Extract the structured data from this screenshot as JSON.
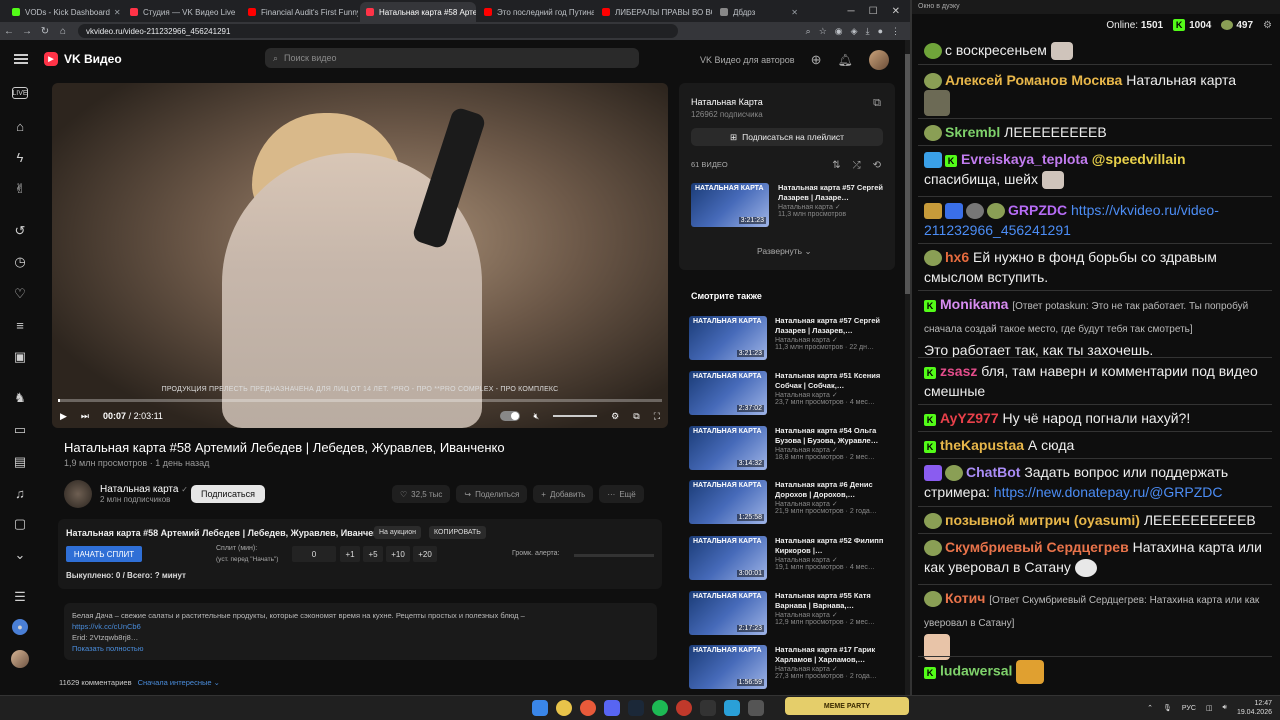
{
  "browser": {
    "tabs": [
      {
        "label": "VODs - Kick Dashboard",
        "color": "#53fc18",
        "active": false
      },
      {
        "label": "Студия — VK Видео Live",
        "color": "#ff3347",
        "active": false
      },
      {
        "label": "Financial Audit's First Funny",
        "color": "#ff0000",
        "active": false
      },
      {
        "label": "Натальная карта #58 Артем",
        "color": "#ff3347",
        "active": true
      },
      {
        "label": "Это последний год Путина",
        "color": "#ff0000",
        "active": false
      },
      {
        "label": "ЛИБЕРАЛЫ ПРАВЫ ВО ВСЁМ",
        "color": "#ff0000",
        "active": false
      },
      {
        "label": "Дбдрз",
        "color": "#888888",
        "active": false
      }
    ],
    "url": "vkvideo.ru/video-211232966_456241291"
  },
  "vk": {
    "logo": "VK Видео",
    "search_placeholder": "Поиск видео",
    "for_authors": "VK Видео для авторов",
    "video": {
      "subtitle": "ПРОДУКЦИЯ ПРЕЛЕСТЬ ПРЕДНАЗНАЧЕНА ДЛЯ ЛИЦ ОТ 14 ЛЕТ. *PRO - ПРО **PRO COMPLEX - ПРО КОМПЛЕКС",
      "time_current": "00:07",
      "time_total": "/ 2:03:11",
      "progress": 0.001
    },
    "title": "Натальная карта #58 Артемий Лебедев | Лебедев, Журавлев, Иванченко",
    "views": "1,9 млн просмотров",
    "age": "1 день назад",
    "channel": {
      "name": "Натальная карта",
      "subs": "2 млн подписчиков",
      "subscribe": "Подписаться"
    },
    "actions": {
      "likes": "32,5 тыс",
      "share": "Поделиться",
      "add": "Добавить",
      "more": "Ещё"
    },
    "split": {
      "title": "Натальная карта #58 Артемий Лебедев | Лебедев, Журавлев, Иванченко",
      "tag_auction": "На аукцион",
      "tag_copy": "КОПИРОВАТЬ",
      "start_button": "НАЧАТЬ СПЛИТ",
      "minutes_label": "Сплит (мин):",
      "minutes_hint": "(уст. перед \"Начать\")",
      "value": "0",
      "steps": [
        "+1",
        "+5",
        "+10",
        "+20"
      ],
      "volume_label": "Громк. алерта:",
      "bought": "Выкуплено: 0 / Всего: ? минут"
    },
    "description": {
      "text": "Белая Дача – свежие салаты и растительные продукты, которые сэкономят время на кухне. Рецепты простых и полезных блюд –",
      "link": "https://vk.cc/cUnCb6",
      "erid": "Erid: 2Vtzqwb8rj8…",
      "show_more": "Показать полностью"
    },
    "comments": {
      "count": "11629 комментариев",
      "sort": "Сначала интересные"
    },
    "playlist": {
      "title": "Натальная Карта",
      "subs": "126962 подписчика",
      "subscribe": "Подписаться на плейлист",
      "count": "61 ВИДЕО",
      "item": {
        "title": "Натальная карта #57 Сергей Лазарев | Лазаре…",
        "channel": "Натальная карта",
        "views": "11,3 млн просмотров",
        "duration": "3:21:23"
      },
      "expand": "Развернуть"
    },
    "see_also_title": "Смотрите также",
    "recommendations": [
      {
        "title": "Натальная карта #57 Сергей Лазарев | Лазарев,…",
        "views": "11,3 млн просмотров · 22 дн…",
        "duration": "3:21:23"
      },
      {
        "title": "Натальная карта #51 Ксения Собчак | Собчак,…",
        "views": "23,7 млн просмотров · 4 мес…",
        "duration": "2:37:02"
      },
      {
        "title": "Натальная карта #54 Ольга Бузова | Бузова, Журавле…",
        "views": "18,8 млн просмотров · 2 мес…",
        "duration": "3:14:32"
      },
      {
        "title": "Натальная карта #6 Денис Дорохов | Дорохов,…",
        "views": "21,9 млн просмотров · 2 года…",
        "duration": "1:25:58"
      },
      {
        "title": "Натальная карта #52 Филипп Киркоров |…",
        "views": "19,1 млн просмотров · 4 мес…",
        "duration": "3:00:01"
      },
      {
        "title": "Натальная карта #55 Катя Варнава | Варнава,…",
        "views": "12,9 млн просмотров · 2 мес…",
        "duration": "2:17:23"
      },
      {
        "title": "Натальная карта #17 Гарик Харламов | Харламов,…",
        "views": "27,3 млн просмотров · 2 года…",
        "duration": "1:56:59"
      }
    ],
    "rec_channel": "Натальная карта"
  },
  "chat": {
    "window_title": "Окно в дуэку",
    "online_label": "Online:",
    "online": "1501",
    "kick_count": "1004",
    "other_count": "497",
    "messages": [
      {
        "user": "",
        "text": "с воскресеньем"
      },
      {
        "user": "Алексей Романов Москва",
        "color": "#e8b74a",
        "text": "Натальная карта"
      },
      {
        "user": "Skrembl",
        "color": "#7fd26b",
        "text": "ЛЕЕЕЕЕЕЕЕЕВ"
      },
      {
        "user": "Evreiskaya_teplota",
        "color": "#c27cf0",
        "text": "@speedvillain",
        "text2": "спасибища, шейх"
      },
      {
        "user": "GRPZDC",
        "color": "#b66cf5",
        "text": "https://vkvideo.ru/video-211232966_456241291"
      },
      {
        "user": "hx6",
        "color": "#e66b3e",
        "text": "Ей нужно в фонд борьбы со здравым смыслом вступить."
      },
      {
        "user": "Monikama",
        "color": "#d78cf0",
        "reply": "[Ответ potaskun: Это не так работает. Ты попробуй сначала создай такое место, где будут тебя так смотреть]",
        "text": "Это работает так, как ты захочешь."
      },
      {
        "user": "zsasz",
        "color": "#e44d8b",
        "text": "бля, там наверн и комментарии под видео смешные"
      },
      {
        "user": "AyYZ977",
        "color": "#e8404a",
        "text": "Ну чё народ погнали нахуй?!"
      },
      {
        "user": "theKapustaa",
        "color": "#e8b74a",
        "text": "А сюда"
      },
      {
        "user": "ChatBot",
        "color": "#a98cf5",
        "text": "Задать вопрос или поддержать стримера:",
        "link": "https://new.donatepay.ru/@GRPZDC"
      },
      {
        "user": "позывной митрич (oyasumi)",
        "color": "#e8b74a",
        "text": "ЛЕЕЕЕЕЕЕЕЕЕВ"
      },
      {
        "user": "Скумбриевый Сердцегрев",
        "color": "#e8734a",
        "text": "Натахина карта или как уверовал в Сатану"
      },
      {
        "user": "Котич",
        "color": "#e8734a",
        "reply": "[Ответ Скумбриевый Сердцегрев: Натахина карта или как уверовал в Сатану]"
      },
      {
        "user": "ludawersal",
        "color": "#7fd26b",
        "text": ""
      }
    ]
  },
  "taskbar": {
    "meme": "MEME PARTY",
    "lang": "РУС",
    "time": "12:47",
    "date": "19.04.2026"
  }
}
